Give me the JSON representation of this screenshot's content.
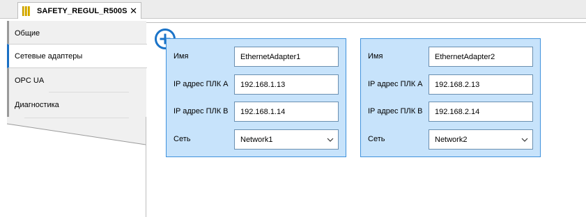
{
  "tab": {
    "title": "SAFETY_REGUL_R500S",
    "icon": "device-module-icon",
    "close_icon": "close-icon"
  },
  "nav": {
    "items": [
      {
        "label": "Общие"
      },
      {
        "label": "Сетевые адаптеры",
        "selected": true
      },
      {
        "label": "OPC UA"
      },
      {
        "label": "Диагностика"
      }
    ]
  },
  "add_button": {
    "icon": "plus-circle-icon",
    "color": "#1a73c8"
  },
  "adapters": [
    {
      "name_label": "Имя",
      "name_value": "EthernetAdapter1",
      "ip_a_label": "IP адрес ПЛК A",
      "ip_a_value": "192.168.1.13",
      "ip_b_label": "IP адрес ПЛК B",
      "ip_b_value": "192.168.1.14",
      "network_label": "Сеть",
      "network_value": "Network1"
    },
    {
      "name_label": "Имя",
      "name_value": "EthernetAdapter2",
      "ip_a_label": "IP адрес ПЛК A",
      "ip_a_value": "192.168.2.13",
      "ip_b_label": "IP адрес ПЛК B",
      "ip_b_value": "192.168.2.14",
      "network_label": "Сеть",
      "network_value": "Network2"
    }
  ],
  "colors": {
    "card_bg": "#c7e3fb",
    "card_border": "#3f92dc",
    "accent": "#1a73c8"
  }
}
